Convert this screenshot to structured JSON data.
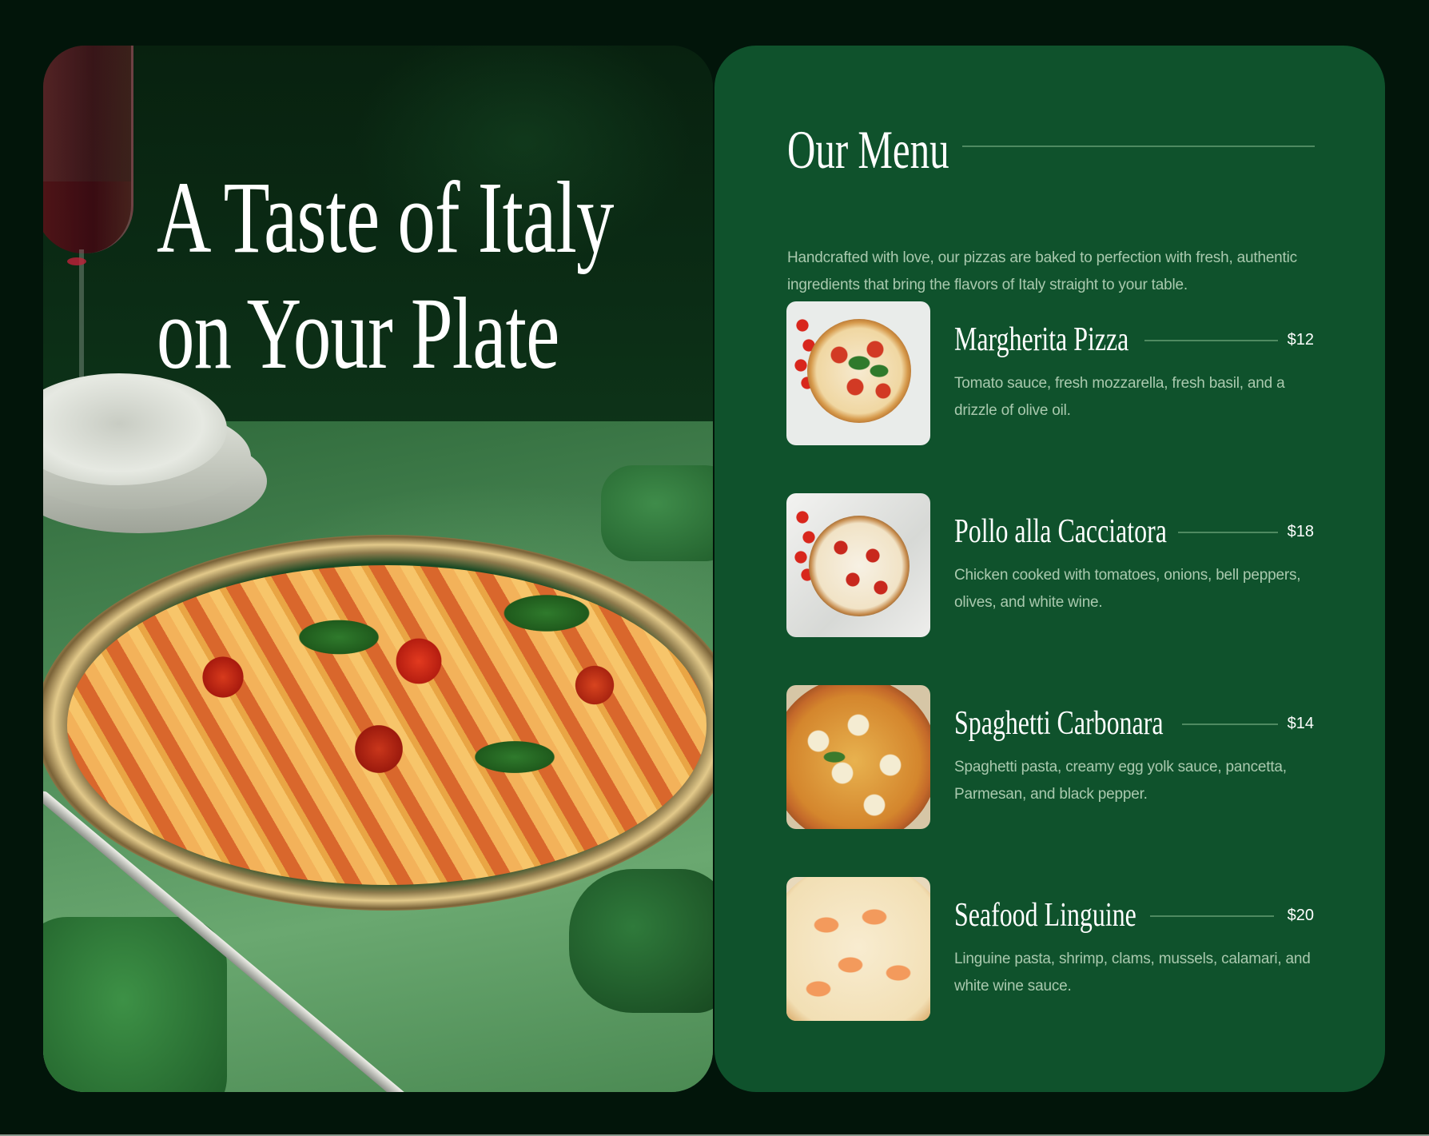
{
  "hero": {
    "title_line1": "A Taste of Italy",
    "title_line2": "on Your Plate",
    "image": "pasta-dish-photo"
  },
  "menu": {
    "title": "Our Menu",
    "intro": "Handcrafted with love, our pizzas are baked to perfection with fresh, authentic ingredients that bring the flavors of Italy straight to your table.",
    "items": [
      {
        "name": "Margherita Pizza",
        "price": "$12",
        "description": "Tomato sauce, fresh mozzarella, fresh basil, and a drizzle of olive oil.",
        "image": "margherita-pizza-photo"
      },
      {
        "name": "Pollo alla Cacciatora",
        "price": "$18",
        "description": "Chicken cooked with tomatoes, onions, bell peppers, olives, and white wine.",
        "image": "pizza-on-marble-photo"
      },
      {
        "name": "Spaghetti Carbonara",
        "price": "$14",
        "description": "Spaghetti pasta, creamy egg yolk sauce, pancetta, Parmesan, and black pepper.",
        "image": "sliced-pizza-photo"
      },
      {
        "name": "Seafood Linguine",
        "price": "$20",
        "description": "Linguine pasta, shrimp, clams, mussels, calamari, and white wine sauce.",
        "image": "shrimp-pizza-photo"
      }
    ]
  },
  "colors": {
    "page_background": "#02150a",
    "menu_card": "#0f522c",
    "heading_text": "#ffffff",
    "body_text": "#a9c9ae",
    "rule": "#4f8a61"
  }
}
